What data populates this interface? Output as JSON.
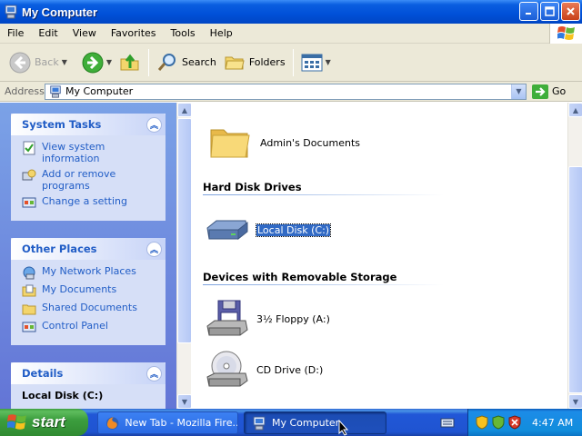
{
  "window": {
    "title": "My Computer",
    "buttons": [
      "minimize",
      "maximize",
      "close"
    ]
  },
  "menubar": {
    "items": [
      "File",
      "Edit",
      "View",
      "Favorites",
      "Tools",
      "Help"
    ]
  },
  "toolbar": {
    "back_label": "Back",
    "search_label": "Search",
    "folders_label": "Folders"
  },
  "address": {
    "label": "Address",
    "value": "My Computer",
    "go_label": "Go"
  },
  "left_panel": {
    "system_tasks": {
      "title": "System Tasks",
      "items": [
        "View system information",
        "Add or remove programs",
        "Change a setting"
      ]
    },
    "other_places": {
      "title": "Other Places",
      "items": [
        "My Network Places",
        "My Documents",
        "Shared Documents",
        "Control Panel"
      ]
    },
    "details": {
      "title": "Details",
      "selected_name": "Local Disk (C:)"
    }
  },
  "content": {
    "top_items": [
      {
        "name": "Admin's Documents",
        "icon": "folder-icon"
      }
    ],
    "groups": [
      {
        "heading": "Hard Disk Drives",
        "items": [
          {
            "name": "Local Disk (C:)",
            "icon": "hard-disk-icon",
            "selected": true
          }
        ]
      },
      {
        "heading": "Devices with Removable Storage",
        "items": [
          {
            "name": "3½ Floppy (A:)",
            "icon": "floppy-drive-icon"
          },
          {
            "name": "CD Drive (D:)",
            "icon": "cd-drive-icon"
          }
        ]
      }
    ]
  },
  "taskbar": {
    "start_label": "start",
    "tasks": [
      {
        "label": "New Tab - Mozilla Fire...",
        "active": false
      },
      {
        "label": "My Computer",
        "active": true
      }
    ],
    "clock": "4:47 AM"
  },
  "colors": {
    "title_blue": "#0050d8",
    "panel_link": "#215dc6",
    "selection": "#316ac5",
    "start_green": "#3c9e3e"
  }
}
